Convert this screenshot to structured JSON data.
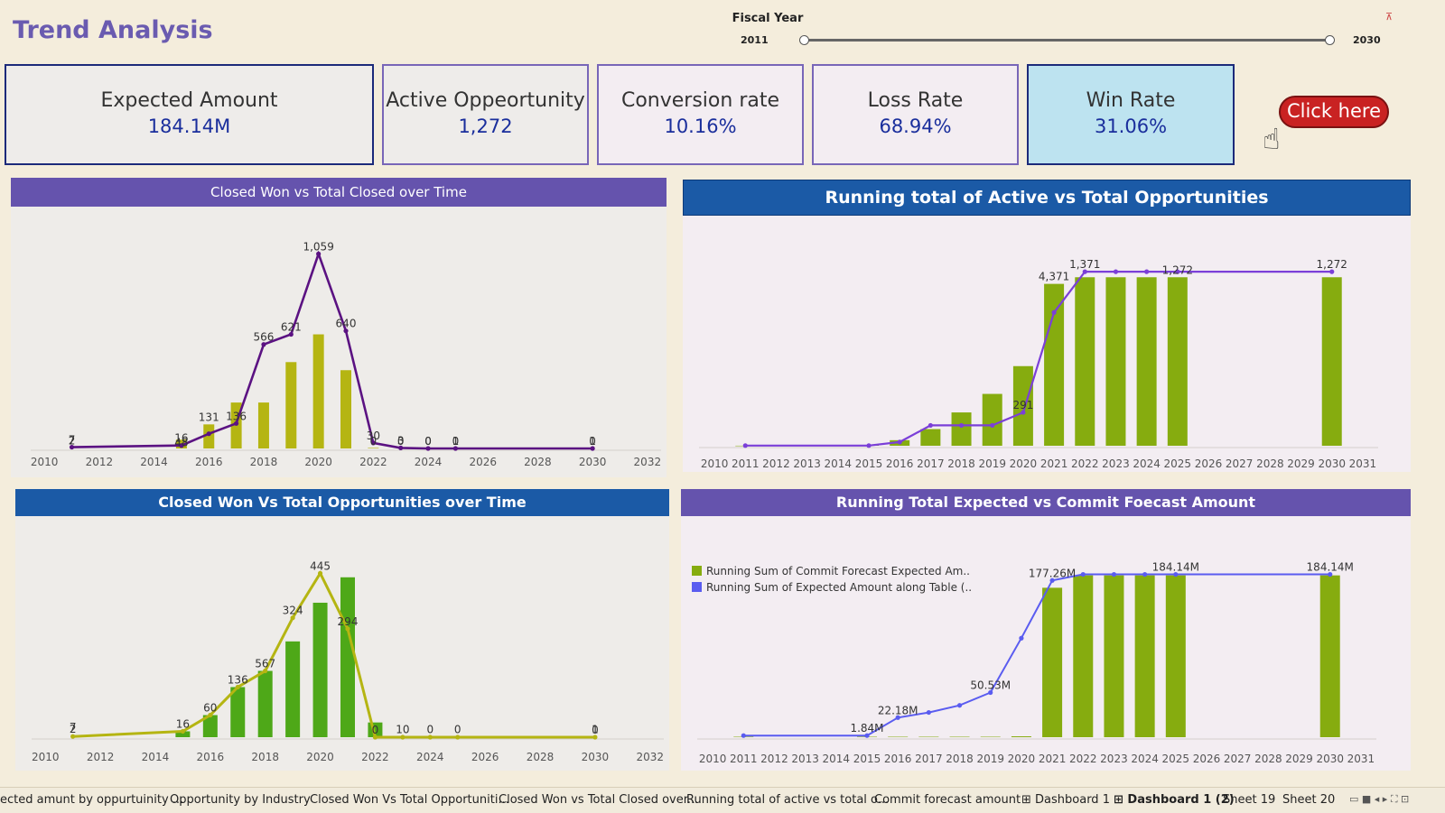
{
  "title": "Trend Analysis",
  "filter": {
    "label": "Fiscal Year",
    "min_label": "2011",
    "max_label": "2030",
    "clear_icon": "filter-clear-icon"
  },
  "kpis": [
    {
      "label": "Expected Amount",
      "value": "184.14M"
    },
    {
      "label": "Active Oppeortunity",
      "value": "1,272"
    },
    {
      "label": "Conversion rate",
      "value": "10.16%"
    },
    {
      "label": "Loss Rate",
      "value": "68.94%"
    },
    {
      "label": "Win Rate",
      "value": "31.06%"
    }
  ],
  "cta": {
    "label": "Click here",
    "icon": "pointing-hand-icon"
  },
  "colors": {
    "kpi_highlight": "#bde3f0",
    "purple_header": "#6553ad",
    "blue_header": "#1b5aa6",
    "purple_line": "#5b1282",
    "olive": "#b5b512",
    "green": "#4ea818",
    "light_green": "#86ac0f",
    "violet_line": "#7b3fd8",
    "blue_line": "#5a5cf0"
  },
  "tabs": [
    {
      "label": "ected amunt by oppurtuinity ...",
      "icon": ""
    },
    {
      "label": "Opportunity by Industry",
      "icon": ""
    },
    {
      "label": "Closed Won Vs Total Opportuniti...",
      "icon": ""
    },
    {
      "label": "Closed Won vs Total Closed over...",
      "icon": ""
    },
    {
      "label": "Running total of active vs total o...",
      "icon": ""
    },
    {
      "label": "Commit forecast amount",
      "icon": ""
    },
    {
      "label": "Dashboard 1",
      "icon": "dashboard-icon"
    },
    {
      "label": "Dashboard 1 (2)",
      "icon": "dashboard-icon"
    },
    {
      "label": "Sheet 19",
      "icon": ""
    },
    {
      "label": "Sheet 20",
      "icon": ""
    }
  ],
  "chart_data": [
    {
      "type": "bar",
      "title": "Closed Won vs Total Closed over Time",
      "xlabel": "Fiscal Year",
      "x_ticks": [
        "2010",
        "2012",
        "2014",
        "2016",
        "2018",
        "2020",
        "2022",
        "2024",
        "2026",
        "2028",
        "2030",
        "2032"
      ],
      "xlim": [
        2009.5,
        2032.5
      ],
      "ylim": [
        0,
        1100
      ],
      "series": [
        {
          "kind": "bar",
          "points": [
            [
              2015,
              48
            ],
            [
              2016,
              131
            ],
            [
              2017,
              250
            ],
            [
              2018,
              250
            ],
            [
              2019,
              470
            ],
            [
              2020,
              621
            ],
            [
              2021,
              426
            ],
            [
              2022,
              3
            ]
          ]
        },
        {
          "kind": "line",
          "points": [
            [
              2011,
              7
            ],
            [
              2015,
              16
            ],
            [
              2016,
              80
            ],
            [
              2017,
              136
            ],
            [
              2018,
              566
            ],
            [
              2019,
              621
            ],
            [
              2020,
              1059
            ],
            [
              2021,
              640
            ],
            [
              2022,
              30
            ],
            [
              2023,
              3
            ],
            [
              2024,
              0
            ],
            [
              2025,
              0
            ],
            [
              2030,
              0
            ]
          ]
        }
      ],
      "labels": [
        {
          "x": 2011,
          "y": 2,
          "text": "2"
        },
        {
          "x": 2011,
          "y": 7,
          "text": "7"
        },
        {
          "x": 2015,
          "y": 16,
          "text": "16"
        },
        {
          "x": 2015,
          "y": -8,
          "text": "48"
        },
        {
          "x": 2016,
          "y": 131,
          "text": "131"
        },
        {
          "x": 2017,
          "y": 136,
          "text": "136"
        },
        {
          "x": 2018,
          "y": 566,
          "text": "566"
        },
        {
          "x": 2019,
          "y": 621,
          "text": "621"
        },
        {
          "x": 2020,
          "y": 1059,
          "text": "1,059"
        },
        {
          "x": 2021,
          "y": 640,
          "text": "640"
        },
        {
          "x": 2022,
          "y": 30,
          "text": "30"
        },
        {
          "x": 2022,
          "y": 0,
          "text": "0"
        },
        {
          "x": 2023,
          "y": 3,
          "text": "3"
        },
        {
          "x": 2023,
          "y": 0,
          "text": "0"
        },
        {
          "x": 2024,
          "y": 0,
          "text": "0"
        },
        {
          "x": 2024,
          "y": 0,
          "text": "0"
        },
        {
          "x": 2025,
          "y": 1,
          "text": "1"
        },
        {
          "x": 2025,
          "y": 0,
          "text": "0"
        },
        {
          "x": 2030,
          "y": 0,
          "text": "0"
        },
        {
          "x": 2030,
          "y": 1,
          "text": "1"
        }
      ]
    },
    {
      "type": "bar",
      "title": "Running total of Active vs Total Opportunities",
      "xlabel": "Fiscal Year",
      "x_ticks": [
        "2010",
        "2011",
        "2012",
        "2013",
        "2014",
        "2015",
        "2016",
        "2017",
        "2018",
        "2019",
        "2020",
        "2021",
        "2022",
        "2023",
        "2024",
        "2025",
        "2026",
        "2027",
        "2028",
        "2029",
        "2030",
        "2031"
      ],
      "xlim": [
        2009.5,
        2031.5
      ],
      "ylim": [
        0,
        4800
      ],
      "series": [
        {
          "kind": "bar",
          "points": [
            [
              2011,
              2
            ],
            [
              2015,
              20
            ],
            [
              2016,
              150
            ],
            [
              2017,
              450
            ],
            [
              2018,
              900
            ],
            [
              2019,
              1400
            ],
            [
              2020,
              2150
            ],
            [
              2021,
              4371
            ],
            [
              2022,
              4550
            ],
            [
              2023,
              4550
            ],
            [
              2024,
              4550
            ],
            [
              2025,
              4550
            ],
            [
              2030,
              4550
            ]
          ]
        },
        {
          "kind": "line",
          "points": [
            [
              2011,
              5
            ],
            [
              2015,
              5
            ],
            [
              2016,
              100
            ],
            [
              2017,
              550
            ],
            [
              2018,
              550
            ],
            [
              2019,
              550
            ],
            [
              2020,
              900
            ],
            [
              2021,
              3600
            ],
            [
              2022,
              4700
            ],
            [
              2023,
              4700
            ],
            [
              2024,
              4700
            ],
            [
              2025,
              4700
            ],
            [
              2030,
              4700
            ]
          ]
        }
      ],
      "labels": [
        {
          "x": 2021,
          "y": 4371,
          "text": "4,371"
        },
        {
          "x": 2022,
          "y": 4700,
          "text": "1,371"
        },
        {
          "x": 2025,
          "y": 4550,
          "text": "1,272"
        },
        {
          "x": 2020,
          "y": 900,
          "text": "291"
        },
        {
          "x": 2030,
          "y": 4700,
          "text": "1,272"
        }
      ]
    },
    {
      "type": "bar",
      "title": "Closed Won Vs Total Opportunities over Time",
      "xlabel": "Fiscal Year",
      "x_ticks": [
        "2010",
        "2012",
        "2014",
        "2016",
        "2018",
        "2020",
        "2022",
        "2024",
        "2026",
        "2028",
        "2030",
        "2032"
      ],
      "xlim": [
        2009.5,
        2032.5
      ],
      "ylim": [
        0,
        480
      ],
      "series": [
        {
          "kind": "bar",
          "points": [
            [
              2015,
              16
            ],
            [
              2016,
              60
            ],
            [
              2017,
              136
            ],
            [
              2018,
              180
            ],
            [
              2019,
              260
            ],
            [
              2020,
              365
            ],
            [
              2021,
              434
            ],
            [
              2022,
              40
            ]
          ]
        },
        {
          "kind": "line",
          "points": [
            [
              2011,
              2
            ],
            [
              2015,
              16
            ],
            [
              2016,
              60
            ],
            [
              2017,
              136
            ],
            [
              2018,
              180
            ],
            [
              2019,
              324
            ],
            [
              2020,
              445
            ],
            [
              2021,
              294
            ],
            [
              2022,
              0
            ],
            [
              2023,
              0
            ],
            [
              2024,
              0
            ],
            [
              2025,
              0
            ],
            [
              2030,
              0
            ]
          ]
        }
      ],
      "labels": [
        {
          "x": 2011,
          "y": 7,
          "text": "7"
        },
        {
          "x": 2011,
          "y": 2,
          "text": "2"
        },
        {
          "x": 2015,
          "y": 16,
          "text": "16"
        },
        {
          "x": 2016,
          "y": 60,
          "text": "60"
        },
        {
          "x": 2017,
          "y": 136,
          "text": "136"
        },
        {
          "x": 2018,
          "y": 180,
          "text": "567"
        },
        {
          "x": 2019,
          "y": 324,
          "text": "324"
        },
        {
          "x": 2020,
          "y": 445,
          "text": "445"
        },
        {
          "x": 2021,
          "y": 294,
          "text": "294"
        },
        {
          "x": 2022,
          "y": 0,
          "text": "0"
        },
        {
          "x": 2023,
          "y": 1,
          "text": "10"
        },
        {
          "x": 2024,
          "y": 1,
          "text": "0"
        },
        {
          "x": 2025,
          "y": 1,
          "text": "0"
        },
        {
          "x": 2030,
          "y": 1,
          "text": "1"
        },
        {
          "x": 2030,
          "y": 0,
          "text": "0"
        }
      ]
    },
    {
      "type": "bar",
      "title": "Running Total Expected vs Commit Foecast Amount",
      "xlabel": "Fiscal Year",
      "x_ticks": [
        "2010",
        "2011",
        "2012",
        "2013",
        "2014",
        "2015",
        "2016",
        "2017",
        "2018",
        "2019",
        "2020",
        "2021",
        "2022",
        "2023",
        "2024",
        "2025",
        "2026",
        "2027",
        "2028",
        "2029",
        "2030",
        "2031"
      ],
      "xlim": [
        2009.5,
        2031.5
      ],
      "ylim": [
        0,
        200
      ],
      "legend": [
        "Running Sum of Commit Forecast Expected Am..",
        "Running Sum of Expected Amount along Table (.."
      ],
      "legend_position": "left",
      "series": [
        {
          "name": "Running Sum of Commit Forecast Expected Am..",
          "kind": "bar",
          "points": [
            [
              2011,
              0.5
            ],
            [
              2015,
              0.5
            ],
            [
              2016,
              0.5
            ],
            [
              2017,
              0.5
            ],
            [
              2018,
              0.5
            ],
            [
              2019,
              0.5
            ],
            [
              2020,
              1
            ],
            [
              2021,
              169
            ],
            [
              2022,
              183
            ],
            [
              2023,
              183
            ],
            [
              2024,
              183
            ],
            [
              2025,
              183
            ],
            [
              2030,
              183
            ]
          ]
        },
        {
          "name": "Running Sum of Expected Amount along Table (..",
          "kind": "line",
          "points": [
            [
              2011,
              1.84
            ],
            [
              2015,
              1.84
            ],
            [
              2016,
              22.18
            ],
            [
              2017,
              28
            ],
            [
              2018,
              36
            ],
            [
              2019,
              50.53
            ],
            [
              2020,
              112
            ],
            [
              2021,
              177.26
            ],
            [
              2022,
              184.14
            ],
            [
              2023,
              184.14
            ],
            [
              2024,
              184.14
            ],
            [
              2025,
              184.14
            ],
            [
              2030,
              184.14
            ]
          ]
        }
      ],
      "labels": [
        {
          "x": 2015,
          "y": 1.84,
          "text": "1.84M"
        },
        {
          "x": 2016,
          "y": 22.18,
          "text": "22.18M"
        },
        {
          "x": 2019,
          "y": 50.53,
          "text": "50.53M"
        },
        {
          "x": 2021,
          "y": 177.26,
          "text": "177.26M"
        },
        {
          "x": 2025,
          "y": 184.14,
          "text": "184.14M"
        },
        {
          "x": 2030,
          "y": 184.14,
          "text": "184.14M"
        }
      ]
    }
  ]
}
